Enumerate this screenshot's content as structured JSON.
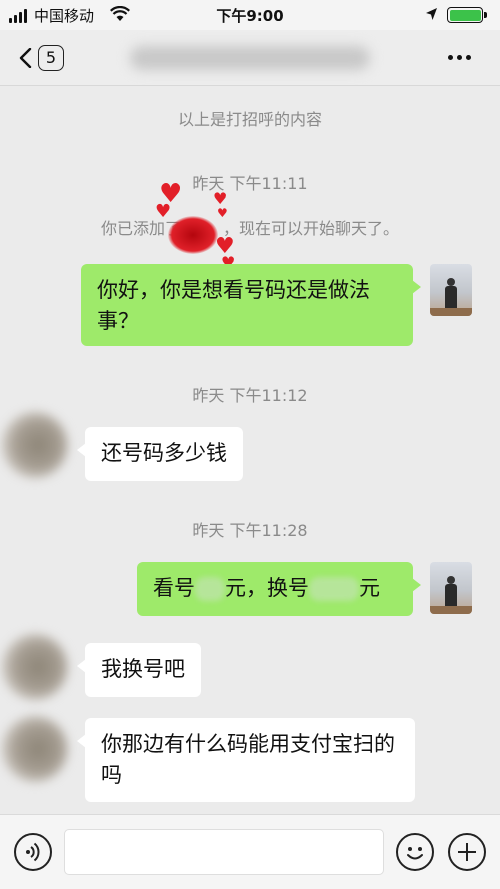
{
  "status_bar": {
    "carrier": "中国移动",
    "time": "下午9:00",
    "icons": [
      "signal-icon",
      "wifi-icon",
      "location-icon",
      "battery-icon"
    ]
  },
  "nav": {
    "back_icon": "chevron-left-icon",
    "unread_count": "5",
    "more_icon": "more-dots-icon"
  },
  "chat": {
    "greeting_note": "以上是打招呼的内容",
    "timestamp_1": "昨天 下午11:11",
    "added_note_prefix": "你已添加了",
    "added_note_suffix": "，现在可以开始聊天了。",
    "message_1": "你好，你是想看号码还是做法事？",
    "timestamp_2": "昨天 下午11:12",
    "message_2": "还号码多少钱",
    "timestamp_3": "昨天 下午11:28",
    "message_3_part_1": "看号",
    "message_3_part_2": "元，换号",
    "message_3_part_3": "元",
    "message_4": "我换号吧",
    "message_5": "你那边有什么码能用支付宝扫的吗"
  },
  "input_bar": {
    "voice_icon": "voice-icon",
    "emoji_icon": "emoji-icon",
    "plus_icon": "plus-icon",
    "input_value": ""
  },
  "colors": {
    "outgoing_bubble": "#9eea6a",
    "incoming_bubble": "#ffffff",
    "chat_background": "#ebebeb",
    "battery": "#3cc24a",
    "sticker": "#e21f28"
  }
}
